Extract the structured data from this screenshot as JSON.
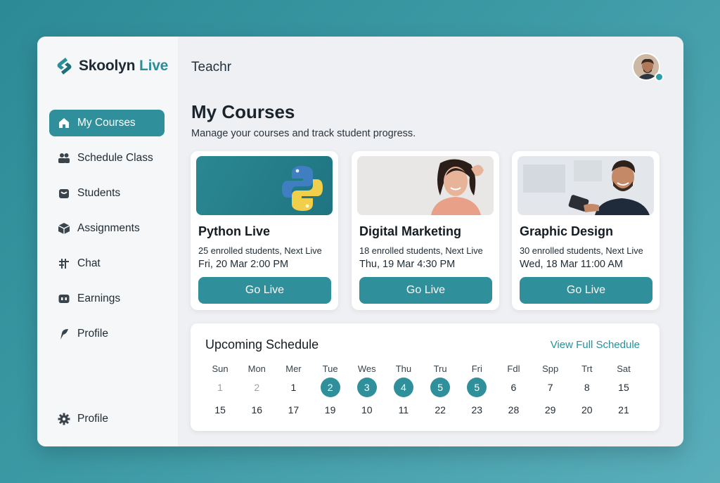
{
  "brand": {
    "name_part1": "Skoolyn",
    "name_part2": "Live"
  },
  "sidebar": {
    "items": [
      {
        "label": "My Courses",
        "icon": "home-icon",
        "active": true
      },
      {
        "label": "Schedule Class",
        "icon": "users-icon"
      },
      {
        "label": "Students",
        "icon": "student-icon"
      },
      {
        "label": "Assignments",
        "icon": "box-icon"
      },
      {
        "label": "Chat",
        "icon": "chat-icon"
      },
      {
        "label": "Earnings",
        "icon": "wallet-icon"
      },
      {
        "label": "Profile",
        "icon": "flag-icon"
      }
    ],
    "bottom": {
      "label": "Profile",
      "icon": "gear-icon"
    }
  },
  "header": {
    "title": "Teachr"
  },
  "page": {
    "title": "My Courses",
    "subtitle": "Manage your courses and track student progress."
  },
  "courses": [
    {
      "title": "Python Live",
      "meta1": "25 enrolled students, Next Live",
      "meta2": "Fri, 20 Mar 2:00 PM",
      "button": "Go Live"
    },
    {
      "title": "Digital Marketing",
      "meta1": "18 enrolled students, Next Live",
      "meta2": "Thu, 19 Mar 4:30 PM",
      "button": "Go Live"
    },
    {
      "title": "Graphic Design",
      "meta1": "30 enrolled students, Next Live",
      "meta2": "Wed, 18 Mar 11:00 AM",
      "button": "Go Live"
    }
  ],
  "schedule": {
    "title": "Upcoming Schedule",
    "link": "View Full Schedule",
    "days": [
      "Sun",
      "Mon",
      "Mer",
      "Tue",
      "Wes",
      "Thu",
      "Tru",
      "Fri",
      "Fdl",
      "Spp",
      "Trt",
      "Sat"
    ],
    "row1": [
      "1",
      "2",
      "1",
      "2",
      "3",
      "4",
      "5",
      "5",
      "6",
      "7",
      "8",
      "15"
    ],
    "row2": [
      "15",
      "16",
      "17",
      "19",
      "10",
      "11",
      "22",
      "23",
      "28",
      "29",
      "20",
      "21"
    ]
  },
  "colors": {
    "accent": "#2f8f9b",
    "background": "#3c9aa5"
  }
}
